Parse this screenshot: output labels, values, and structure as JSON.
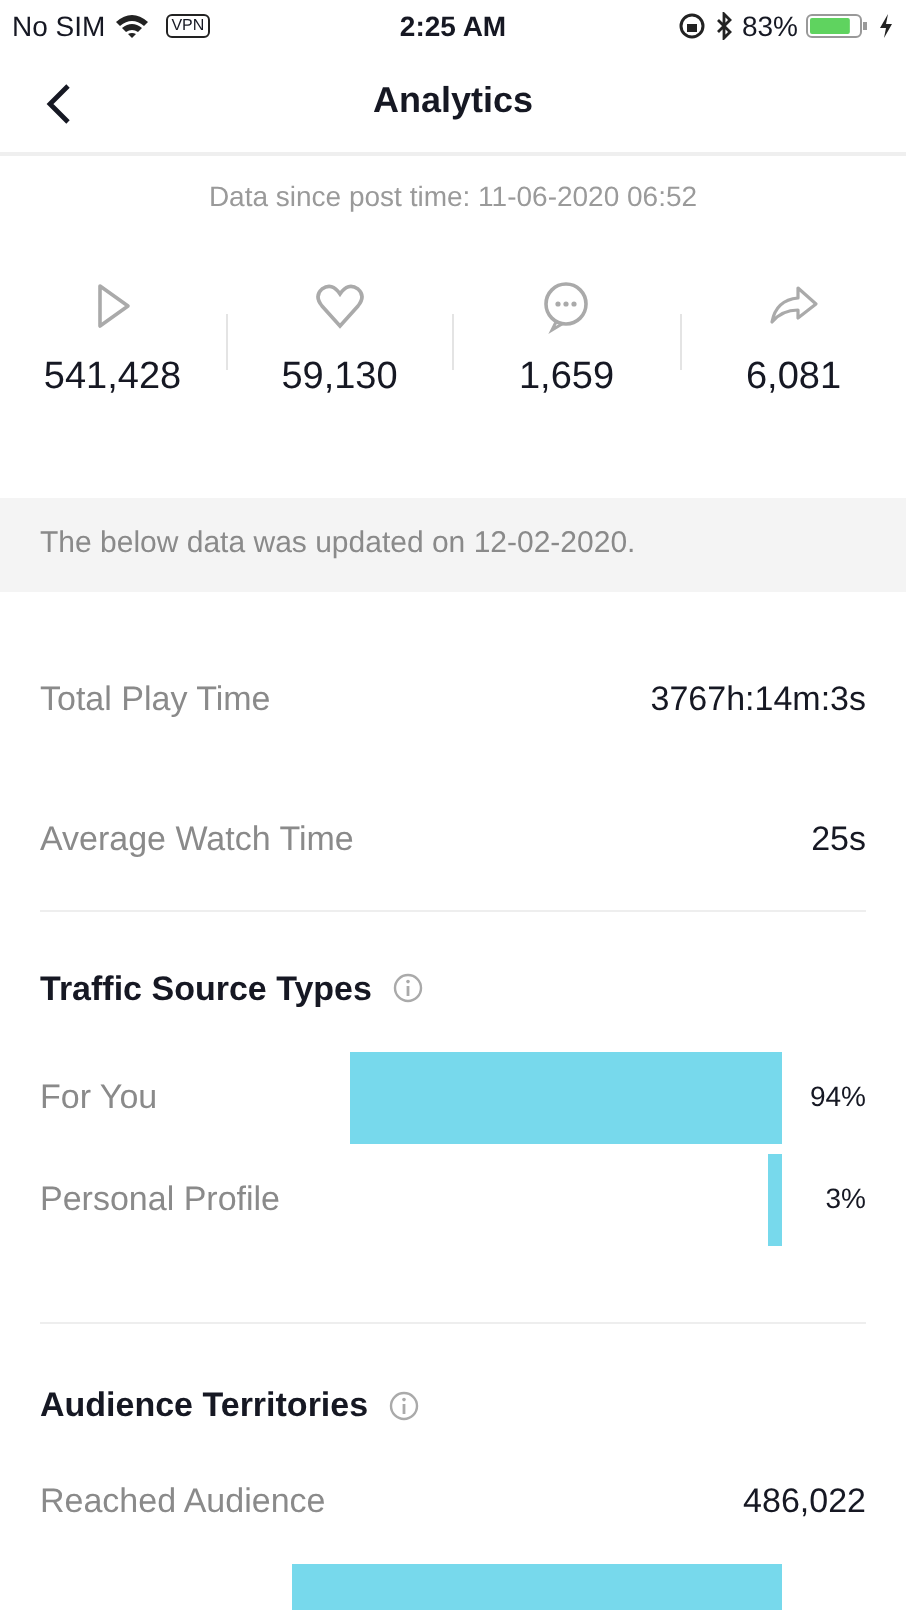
{
  "status_bar": {
    "carrier": "No SIM",
    "vpn": "VPN",
    "time": "2:25 AM",
    "battery": "83%"
  },
  "header": {
    "title": "Analytics"
  },
  "since": "Data since post time: 11-06-2020 06:52",
  "stats": [
    {
      "kind": "play",
      "value": "541,428"
    },
    {
      "kind": "like",
      "value": "59,130"
    },
    {
      "kind": "comment",
      "value": "1,659"
    },
    {
      "kind": "share",
      "value": "6,081"
    }
  ],
  "notice": "The below data was updated on 12-02-2020.",
  "metrics": [
    {
      "label": "Total Play Time",
      "value": "3767h:14m:3s"
    },
    {
      "label": "Average Watch Time",
      "value": "25s"
    }
  ],
  "traffic": {
    "title": "Traffic Source Types",
    "rows": [
      {
        "label": "For You",
        "reading": "94%"
      },
      {
        "label": "Personal Profile",
        "reading": "3%"
      }
    ]
  },
  "territories": {
    "title": "Audience Territories",
    "reached_label": "Reached Audience",
    "reached_value": "486,022",
    "rows": [
      {
        "kind": "bar"
      }
    ]
  }
}
